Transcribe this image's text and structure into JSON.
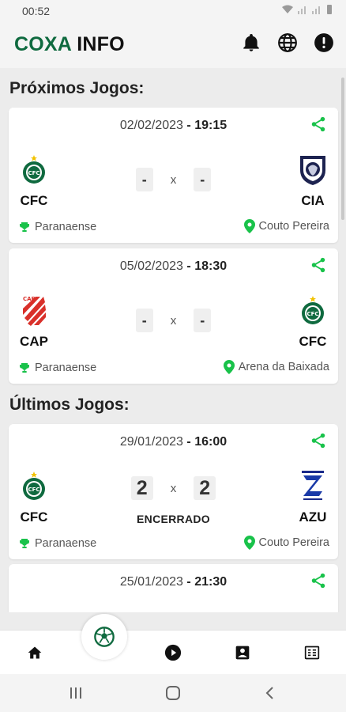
{
  "status_bar": {
    "time": "00:52"
  },
  "app": {
    "brand_part1": "COXA",
    "brand_part2": "INFO"
  },
  "header_actions": [
    "bell-icon",
    "globe-icon",
    "info-icon"
  ],
  "sections": {
    "upcoming_title": "Próximos Jogos:",
    "past_title": "Últimos Jogos:"
  },
  "upcoming": [
    {
      "date": "02/02/2023",
      "sep": "-",
      "time": "19:15",
      "home": "CFC",
      "away": "CIA",
      "home_score": "-",
      "away_score": "-",
      "vs": "x",
      "competition": "Paranaense",
      "venue": "Couto Pereira"
    },
    {
      "date": "05/02/2023",
      "sep": "-",
      "time": "18:30",
      "home": "CAP",
      "away": "CFC",
      "home_score": "-",
      "away_score": "-",
      "vs": "x",
      "competition": "Paranaense",
      "venue": "Arena da Baixada"
    }
  ],
  "past": [
    {
      "date": "29/01/2023",
      "sep": "-",
      "time": "16:00",
      "home": "CFC",
      "away": "AZU",
      "home_score": "2",
      "away_score": "2",
      "vs": "x",
      "status": "ENCERRADO",
      "competition": "Paranaense",
      "venue": "Couto Pereira"
    },
    {
      "date": "25/01/2023",
      "sep": "-",
      "time": "21:30"
    }
  ],
  "colors": {
    "brand_green": "#0f6a3f",
    "accent_green": "#19c24a",
    "cap_red": "#d9302a"
  },
  "bottom_nav": [
    "home-icon",
    "soccer-ball-icon",
    "play-icon",
    "contacts-icon",
    "news-icon"
  ]
}
